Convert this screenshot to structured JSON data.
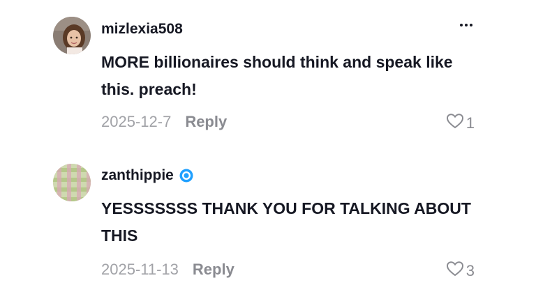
{
  "comments": [
    {
      "username": "mizlexia508",
      "text": "MORE billionaires should think and speak like this. preach!",
      "date": "2025-12-7",
      "reply_label": "Reply",
      "likes": "1",
      "verified": false
    },
    {
      "username": "zanthippie",
      "text": "YESSSSSSS THANK YOU FOR TALKING ABOUT THIS",
      "date": "2025-11-13",
      "reply_label": "Reply",
      "likes": "3",
      "verified": true
    }
  ],
  "colors": {
    "text": "#161823",
    "muted": "#8a8b91",
    "date": "#a1a2a7",
    "verified": "#20a0ff"
  },
  "icons": [
    "more-options-icon",
    "heart-icon",
    "verified-badge-icon"
  ]
}
